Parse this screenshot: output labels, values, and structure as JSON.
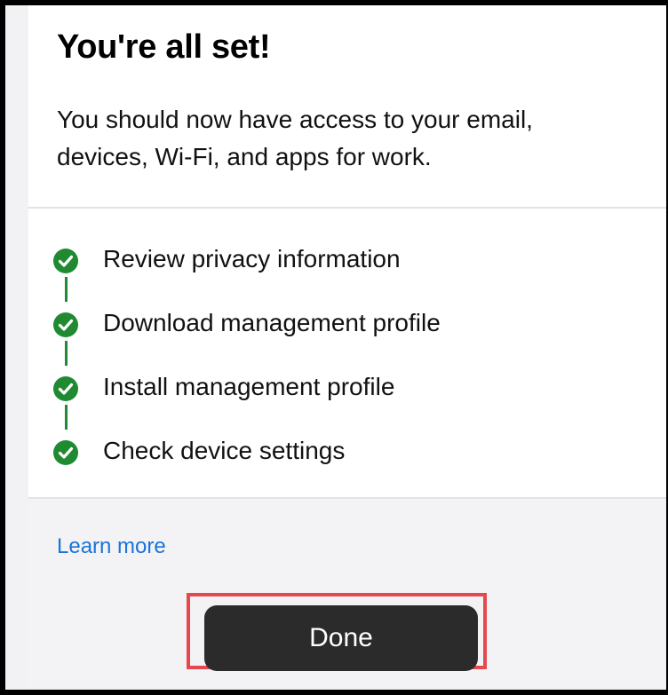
{
  "header": {
    "title": "You're all set!",
    "subtitle": "You should now have access to your email, devices, Wi-Fi, and apps for work."
  },
  "steps": [
    {
      "label": "Review privacy information",
      "status": "complete",
      "icon": "check-circle-icon"
    },
    {
      "label": "Download management profile",
      "status": "complete",
      "icon": "check-circle-icon"
    },
    {
      "label": "Install management profile",
      "status": "complete",
      "icon": "check-circle-icon"
    },
    {
      "label": "Check device settings",
      "status": "complete",
      "icon": "check-circle-icon"
    }
  ],
  "footer": {
    "learn_more_label": "Learn more",
    "done_label": "Done"
  },
  "colors": {
    "success_green": "#1f8a32",
    "link_blue": "#1a73d9",
    "button_dark": "#2b2b2c",
    "highlight_red": "#e5484d"
  }
}
